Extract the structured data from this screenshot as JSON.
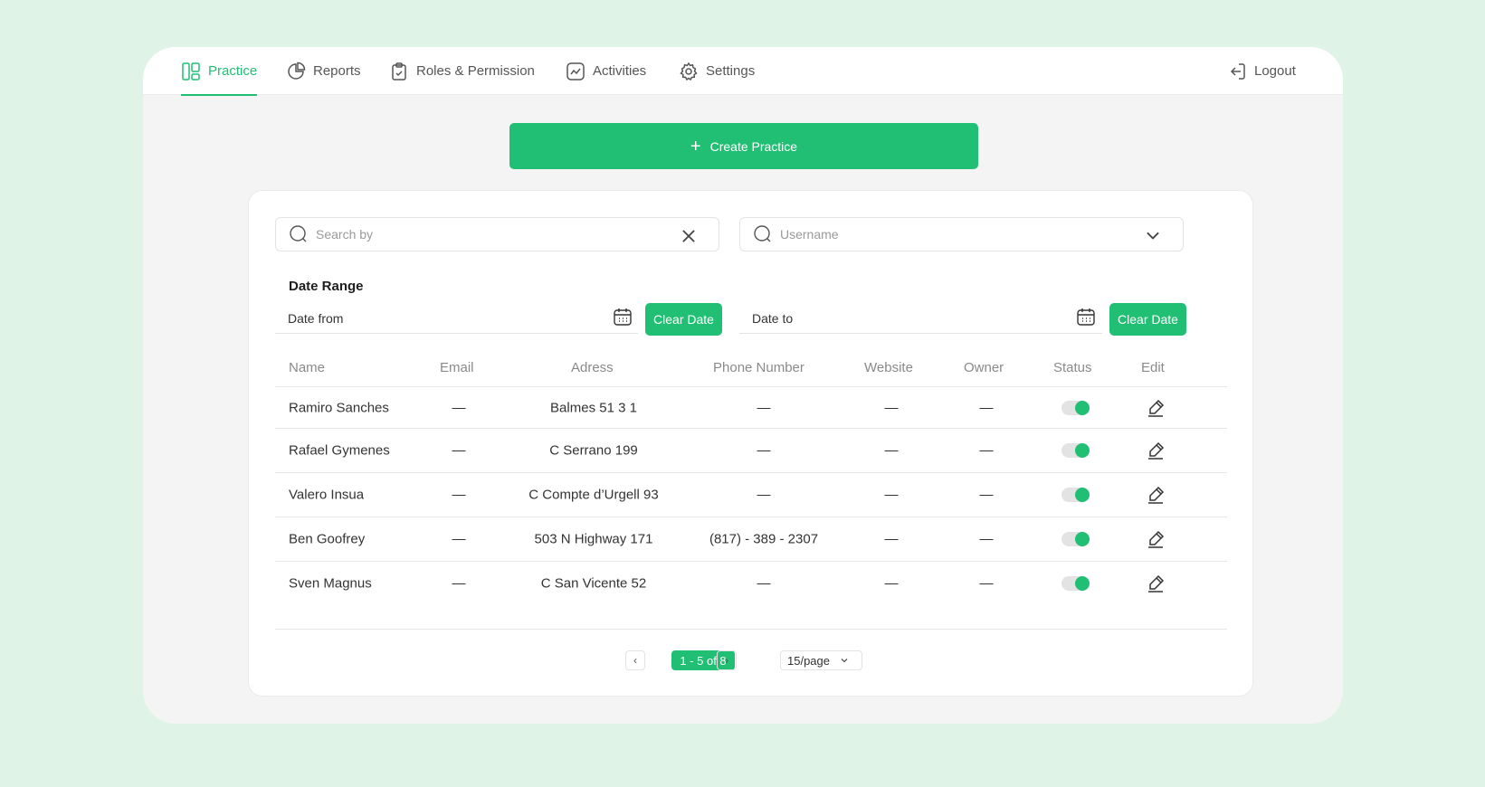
{
  "nav": {
    "items": [
      {
        "label": "Practice",
        "icon": "layout-icon",
        "active": true
      },
      {
        "label": "Reports",
        "icon": "pie-chart-icon"
      },
      {
        "label": "Roles & Permission",
        "icon": "clipboard-check-icon"
      },
      {
        "label": "Activities",
        "icon": "activity-chart-icon"
      },
      {
        "label": "Settings",
        "icon": "gear-icon"
      }
    ],
    "logout_label": "Logout"
  },
  "create_button": {
    "label": "Create Practice",
    "icon": "plus-icon"
  },
  "filters": {
    "search_placeholder": "Search by",
    "username_placeholder": "Username",
    "date_range_title": "Date Range",
    "date_from_label": "Date from",
    "date_to_label": "Date to",
    "clear_date_label": "Clear Date"
  },
  "table": {
    "headers": [
      "Name",
      "Email",
      "Adress",
      "Phone Number",
      "Website",
      "Owner",
      "Status",
      "Edit"
    ],
    "rows": [
      {
        "name": "Ramiro Sanches",
        "email": "—",
        "address": "Balmes 51 3 1",
        "phone": "—",
        "website": "—",
        "owner": "—",
        "status": true
      },
      {
        "name": "Rafael Gymenes",
        "email": "—",
        "address": "C Serrano 199",
        "phone": "—",
        "website": "—",
        "owner": "—",
        "status": true
      },
      {
        "name": "Valero Insua",
        "email": "—",
        "address": "C Compte d’Urgell 93",
        "phone": "—",
        "website": "—",
        "owner": "—",
        "status": true
      },
      {
        "name": "Ben Goofrey",
        "email": "—",
        "address": "503 N Highway 171",
        "phone": "(817) - 389 - 2307",
        "website": "—",
        "owner": "—",
        "status": true
      },
      {
        "name": "Sven Magnus",
        "email": "—",
        "address": "C San Vicente 52",
        "phone": "—",
        "website": "—",
        "owner": "—",
        "status": true
      }
    ]
  },
  "pagination": {
    "info": "1 - 5 of 8",
    "page_size": "15/page",
    "prev": "‹",
    "next": "›"
  },
  "colors": {
    "accent": "#21bf73",
    "background": "#dff3e6"
  }
}
